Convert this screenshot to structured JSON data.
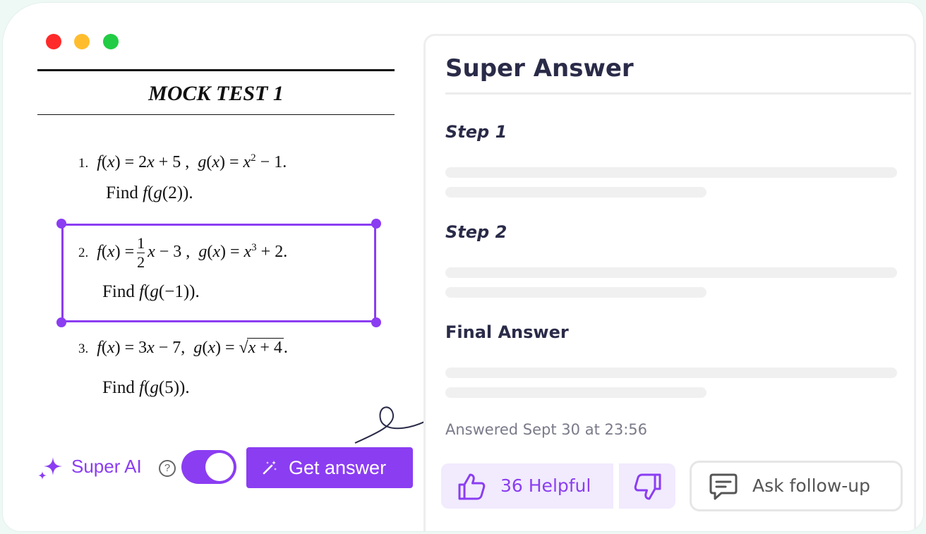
{
  "document": {
    "title": "MOCK TEST 1",
    "problems": [
      {
        "number": "1.",
        "statement": "f(x) = 2x + 5, g(x) = x² − 1.",
        "find": "Find f(g(2))."
      },
      {
        "number": "2.",
        "statement": "f(x) = 1/2 x − 3, g(x) = x³ + 2.",
        "find": "Find f(g(−1))."
      },
      {
        "number": "3.",
        "statement": "f(x) = 3x − 7, g(x) = √(x + 4).",
        "find": "Find f(g(5))."
      }
    ],
    "selected_problem": "2."
  },
  "controls": {
    "super_ai_label": "Super AI",
    "help_symbol": "?",
    "toggle_on": true,
    "get_answer_label": "Get answer"
  },
  "panel": {
    "title": "Super Answer",
    "step1": "Step 1",
    "step2": "Step 2",
    "final": "Final Answer",
    "answered": "Answered Sept 30 at 23:56",
    "helpful_label": "36 Helpful",
    "follow_up_label": "Ask follow-up"
  },
  "colors": {
    "accent": "#8b3df2",
    "accent_light": "#f1ebfd",
    "heading": "#2a2b48",
    "skeleton": "#f0f0f0"
  },
  "icons": {
    "sparkle": "sparkle-icon",
    "help": "help-icon",
    "wand": "magic-wand-icon",
    "like": "thumbs-up-icon",
    "dislike": "thumbs-down-icon",
    "chat": "chat-icon"
  }
}
